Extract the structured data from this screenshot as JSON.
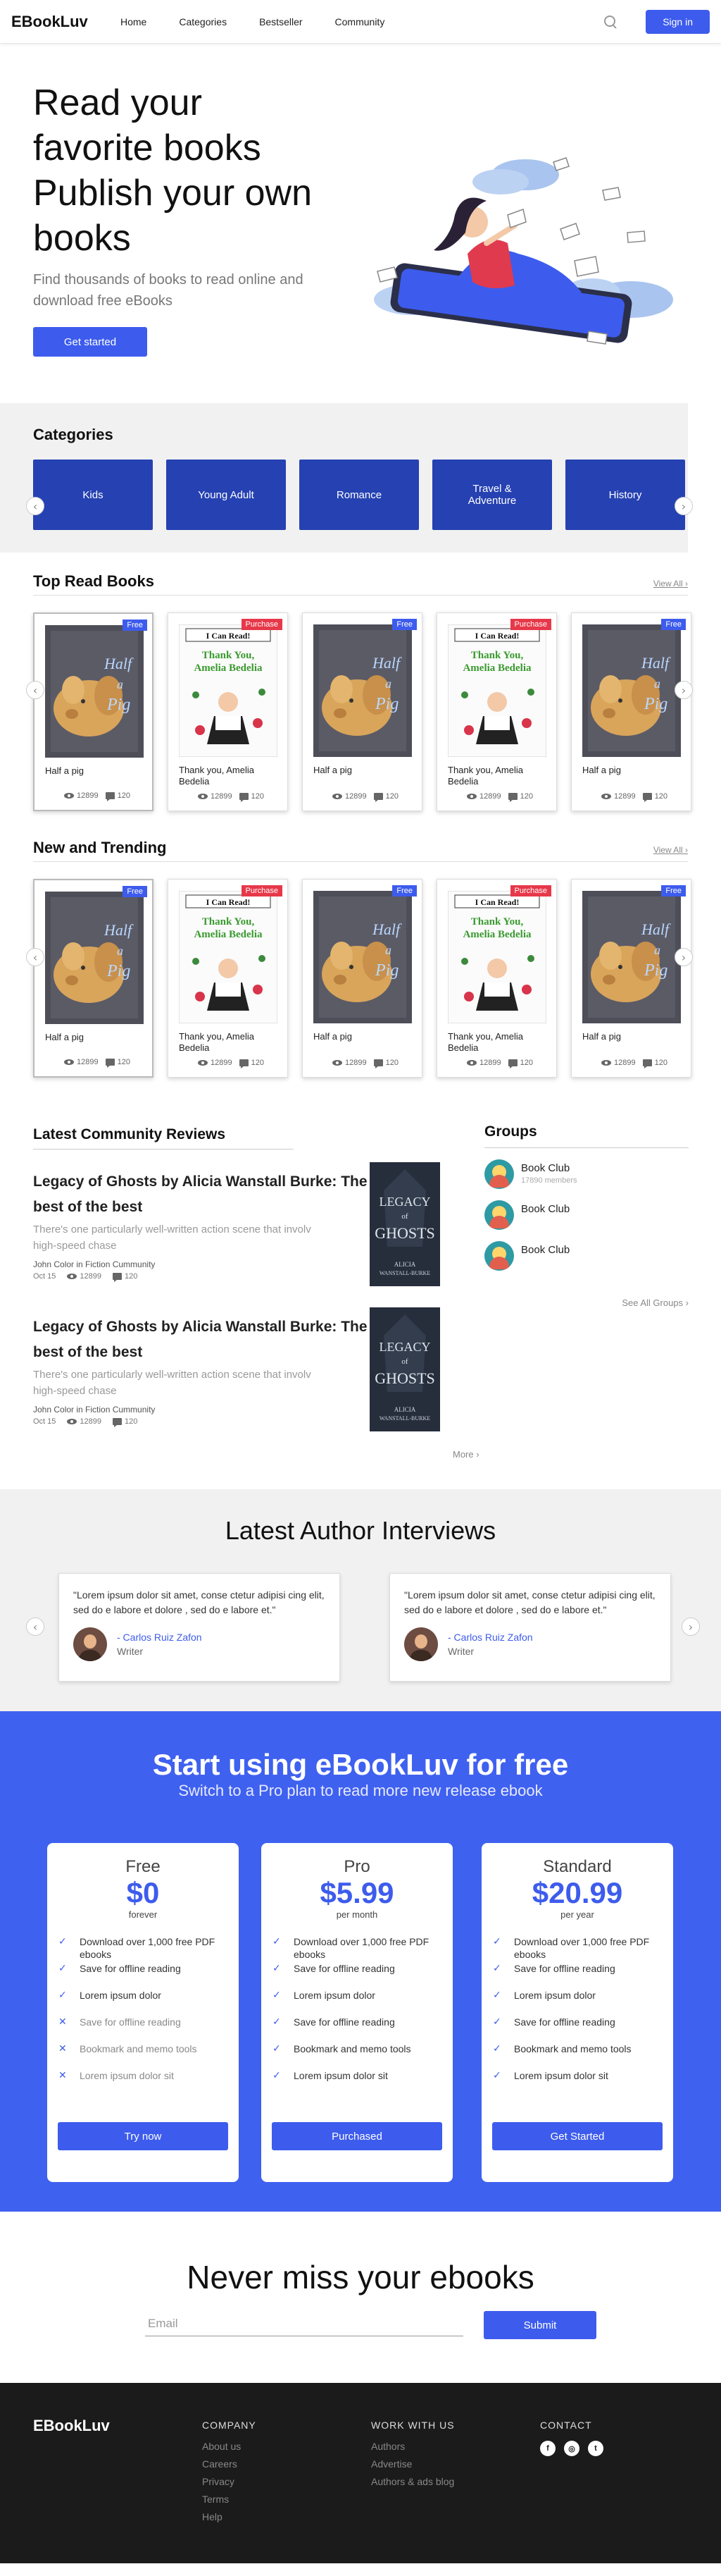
{
  "nav": {
    "logo": "EBookLuv",
    "links": [
      "Home",
      "Categories",
      "Bestseller",
      "Community"
    ],
    "signin": "Sign in"
  },
  "hero": {
    "title_lines": [
      "Read your",
      "favorite books",
      "Publish your own",
      "books"
    ],
    "subtitle": "Find thousands of books to read online and download free eBooks",
    "cta": "Get started"
  },
  "categories": {
    "title": "Categories",
    "items": [
      "Kids",
      "Young Adult",
      "Romance",
      "Travel & Adventure",
      "History"
    ]
  },
  "top_read": {
    "title": "Top Read Books",
    "view_all": "View All",
    "books": [
      {
        "title": "Half a pig",
        "badge": "Free",
        "views": "12899",
        "comments": "120"
      },
      {
        "title": "Thank you, Amelia Bedelia",
        "badge": "Purchase",
        "views": "12899",
        "comments": "120"
      },
      {
        "title": "Half a pig",
        "badge": "Free",
        "views": "12899",
        "comments": "120"
      },
      {
        "title": "Thank you, Amelia Bedelia",
        "badge": "Purchase",
        "views": "12899",
        "comments": "120"
      },
      {
        "title": "Half a pig",
        "badge": "Free",
        "views": "12899",
        "comments": "120"
      }
    ]
  },
  "trending": {
    "title": "New and Trending",
    "view_all": "View All",
    "books": [
      {
        "title": "Half a pig",
        "badge": "Free",
        "views": "12899",
        "comments": "120"
      },
      {
        "title": "Thank you, Amelia Bedelia",
        "badge": "Purchase",
        "views": "12899",
        "comments": "120"
      },
      {
        "title": "Half a pig",
        "badge": "Free",
        "views": "12899",
        "comments": "120"
      },
      {
        "title": "Thank you, Amelia Bedelia",
        "badge": "Purchase",
        "views": "12899",
        "comments": "120"
      },
      {
        "title": "Half a pig",
        "badge": "Free",
        "views": "12899",
        "comments": "120"
      }
    ]
  },
  "cover_text": {
    "pig": [
      "Half",
      "a",
      "Pig"
    ],
    "amelia_top": "I Can Read!",
    "amelia_title": [
      "Thank You,",
      "Amelia Bedelia"
    ],
    "legacy": [
      "LEGACY",
      "of",
      "GHOSTS"
    ],
    "legacy_author": [
      "ALICIA",
      "WANSTALL-BURKE"
    ]
  },
  "reviews": {
    "title": "Latest Community Reviews",
    "items": [
      {
        "heading": "Legacy of Ghosts by Alicia Wanstall Burke: The best of the best",
        "excerpt_lines": [
          "There's one particularly well-written action scene that involv",
          "high-speed chase"
        ],
        "author": "John Color in Fiction Cummunity",
        "date": "Oct 15",
        "views": "12899",
        "comments": "120"
      },
      {
        "heading": "Legacy of Ghosts by Alicia Wanstall Burke: The best of the best",
        "excerpt_lines": [
          "There's one particularly well-written action scene that involv",
          "high-speed chase"
        ],
        "author": "John Color in Fiction Cummunity",
        "date": "Oct 15",
        "views": "12899",
        "comments": "120"
      }
    ],
    "more": "More"
  },
  "groups": {
    "title": "Groups",
    "items": [
      {
        "name": "Book Club",
        "members": "17890 members"
      },
      {
        "name": "Book Club",
        "members": ""
      },
      {
        "name": "Book Club",
        "members": ""
      }
    ],
    "see_all": "See All Groups"
  },
  "interviews": {
    "title": "Latest Author Interviews",
    "quotes": [
      {
        "text": "\"Lorem ipsum dolor sit amet, conse ctetur adipisi cing elit, sed do e labore et dolore , sed do e labore et.\"",
        "author": "- Carlos Ruiz Zafon",
        "role": "Writer"
      },
      {
        "text": "\"Lorem ipsum dolor sit amet, conse ctetur adipisi cing elit, sed do e labore et dolore , sed do e labore et.\"",
        "author": "- Carlos Ruiz Zafon",
        "role": "Writer"
      }
    ]
  },
  "pricing": {
    "title": "Start using eBookLuv for free",
    "subtitle": "Switch to a Pro plan to read more new release ebook",
    "plans": [
      {
        "name": "Free",
        "price": "$0",
        "period": "forever",
        "button": "Try now",
        "features": [
          {
            "text": "Download over 1,000 free PDF ebooks",
            "included": true
          },
          {
            "text": "Save for offline reading",
            "included": true
          },
          {
            "text": "Lorem ipsum dolor",
            "included": true
          },
          {
            "text": "Save for offline reading",
            "included": false
          },
          {
            "text": "Bookmark and memo tools",
            "included": false
          },
          {
            "text": "Lorem ipsum dolor sit",
            "included": false
          }
        ]
      },
      {
        "name": "Pro",
        "price": "$5.99",
        "period": "per month",
        "button": "Purchased",
        "features": [
          {
            "text": "Download over 1,000 free PDF ebooks",
            "included": true
          },
          {
            "text": "Save for offline reading",
            "included": true
          },
          {
            "text": "Lorem ipsum dolor",
            "included": true
          },
          {
            "text": "Save for offline reading",
            "included": true
          },
          {
            "text": "Bookmark and memo tools",
            "included": true
          },
          {
            "text": "Lorem ipsum dolor sit",
            "included": true
          }
        ]
      },
      {
        "name": "Standard",
        "price": "$20.99",
        "period": "per year",
        "button": "Get Started",
        "features": [
          {
            "text": "Download over 1,000 free PDF ebooks",
            "included": true
          },
          {
            "text": "Save for offline reading",
            "included": true
          },
          {
            "text": "Lorem ipsum dolor",
            "included": true
          },
          {
            "text": "Save for offline reading",
            "included": true
          },
          {
            "text": "Bookmark and memo tools",
            "included": true
          },
          {
            "text": "Lorem ipsum dolor sit",
            "included": true
          }
        ]
      }
    ]
  },
  "newsletter": {
    "title": "Never miss your ebooks",
    "placeholder": "Email",
    "submit": "Submit"
  },
  "footer": {
    "logo": "EBookLuv",
    "company": {
      "title": "COMPANY",
      "links": [
        "About us",
        "Careers",
        "Privacy",
        "Terms",
        "Help"
      ]
    },
    "work": {
      "title": "WORK WITH US",
      "links": [
        "Authors",
        "Advertise",
        "Authors & ads blog"
      ]
    },
    "contact": {
      "title": "CONTACT",
      "socials": [
        "f",
        "◎",
        "t"
      ]
    }
  },
  "colors": {
    "primary": "#3d5ced",
    "category_blue": "#2541b2",
    "purchase_red": "#e7384a",
    "pricing_bg": "#3f61f0",
    "footer_bg": "#1b1b1b"
  },
  "icons": [
    "search-icon",
    "chevron-left-icon",
    "chevron-right-icon",
    "eye-icon",
    "comment-icon",
    "check-icon",
    "cross-icon",
    "facebook-icon",
    "instagram-icon",
    "twitter-icon"
  ]
}
